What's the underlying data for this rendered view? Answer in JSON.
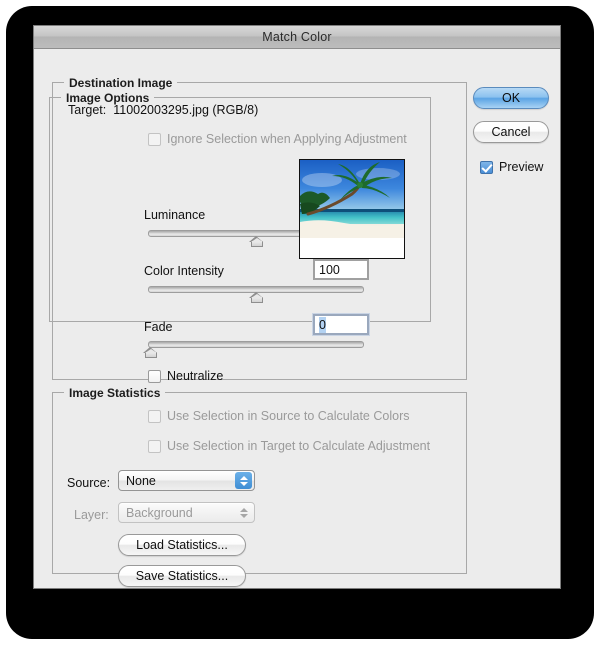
{
  "window": {
    "title": "Match Color"
  },
  "destination": {
    "legend": "Destination Image",
    "target_label": "Target:",
    "target_value": "11002003295.jpg (RGB/8)",
    "ignore_selection_label": "Ignore Selection when Applying Adjustment",
    "ignore_selection_checked": false,
    "ignore_selection_enabled": false
  },
  "image_options": {
    "legend": "Image Options",
    "luminance_label": "Luminance",
    "luminance_value": "100",
    "color_intensity_label": "Color Intensity",
    "color_intensity_value": "100",
    "fade_label": "Fade",
    "fade_value": "0",
    "neutralize_label": "Neutralize",
    "neutralize_checked": false
  },
  "image_statistics": {
    "legend": "Image Statistics",
    "use_source_label": "Use Selection in Source to Calculate Colors",
    "use_source_checked": false,
    "use_target_label": "Use Selection in Target to Calculate Adjustment",
    "use_target_checked": false,
    "source_label": "Source:",
    "source_value": "None",
    "layer_label": "Layer:",
    "layer_value": "Background",
    "load_statistics_label": "Load Statistics...",
    "save_statistics_label": "Save Statistics..."
  },
  "actions": {
    "ok_label": "OK",
    "cancel_label": "Cancel",
    "preview_label": "Preview",
    "preview_checked": true
  },
  "colors": {
    "accent_blue": "#4a8ed6",
    "dialog_background": "#ececec",
    "selection_highlight": "#b3d2f2",
    "backdrop": "#000000"
  }
}
